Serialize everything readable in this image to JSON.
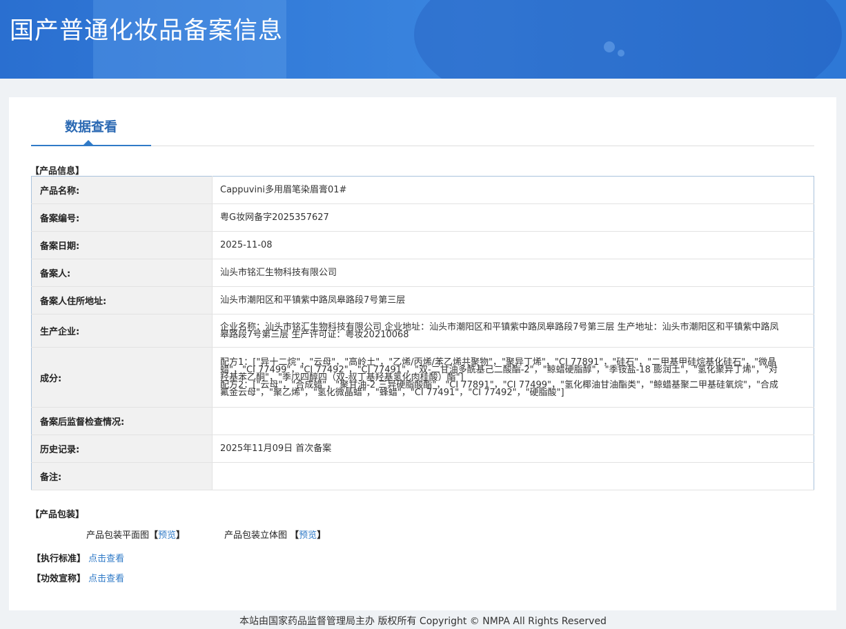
{
  "header": {
    "title": "国产普通化妆品备案信息"
  },
  "tab": {
    "label": "数据查看"
  },
  "product_info": {
    "section_title": "【产品信息】",
    "rows": [
      {
        "label": "产品名称:",
        "value": "Cappuvini多用眉笔染眉膏01#"
      },
      {
        "label": "备案编号:",
        "value": "粤G妆网备字2025357627"
      },
      {
        "label": "备案日期:",
        "value": "2025-11-08"
      },
      {
        "label": "备案人:",
        "value": "汕头市铭汇生物科技有限公司"
      },
      {
        "label": "备案人住所地址:",
        "value": "汕头市潮阳区和平镇紫中路凤皋路段7号第三层"
      },
      {
        "label": "生产企业:",
        "value": "企业名称：汕头市铭汇生物科技有限公司 企业地址：汕头市潮阳区和平镇紫中路凤皋路段7号第三层 生产地址：汕头市潮阳区和平镇紫中路凤皋路段7号第三层 生产许可证：粤妆20210068"
      },
      {
        "label": "成分:",
        "value_lines": [
          "配方1：[\"异十二烷\"，\"云母\"，\"高岭土\"，\"乙烯/丙烯/苯乙烯共聚物\"，\"聚异丁烯\"，\"CI 77891\"，\"硅石\"，\"二甲基甲硅烷基化硅石\"，\"微晶蜡\"，\"CI 77499\"，\"CI 77492\"，\"CI 77491\"，\"双-二甘油多酰基己二酸酯-2\"，\"鲸蜡硬脂醇\"，\"季铵盐-18 膨润土\"，\"氢化聚异丁烯\"，\"对羟基苯乙酮\"，\"季戊四醇四（双-叔丁基羟基氢化肉桂酸）酯\"]",
          "配方2：[\"云母\"，\"合成蜡\"，\"聚甘油-2 三异硬脂酸酯\"，\"CI 77891\"，\"CI 77499\"，\"氢化椰油甘油酯类\"，\"鲸蜡基聚二甲基硅氧烷\"，\"合成氟金云母\"，\"聚乙烯\"，\"氢化微晶蜡\"，\"蜂蜡\"，\"CI 77491\"，\"CI 77492\"，\"硬脂酸\"]"
        ]
      },
      {
        "label": "备案后监督检查情况:",
        "value": ""
      },
      {
        "label": "历史记录:",
        "value": "2025年11月09日 首次备案"
      },
      {
        "label": "备注:",
        "value": ""
      }
    ]
  },
  "packaging": {
    "section_title": "【产品包装】",
    "flat_label": "产品包装平面图",
    "solid_label": "产品包装立体图",
    "preview_link": "预览",
    "bracket_open": "【",
    "bracket_close": "】"
  },
  "standard": {
    "label": "【执行标准】",
    "link": "点击查看"
  },
  "efficacy": {
    "label": "【功效宣称】",
    "link": "点击查看"
  },
  "footer": {
    "text": "本站由国家药品监督管理局主办 版权所有 Copyright © NMPA All Rights Reserved"
  }
}
